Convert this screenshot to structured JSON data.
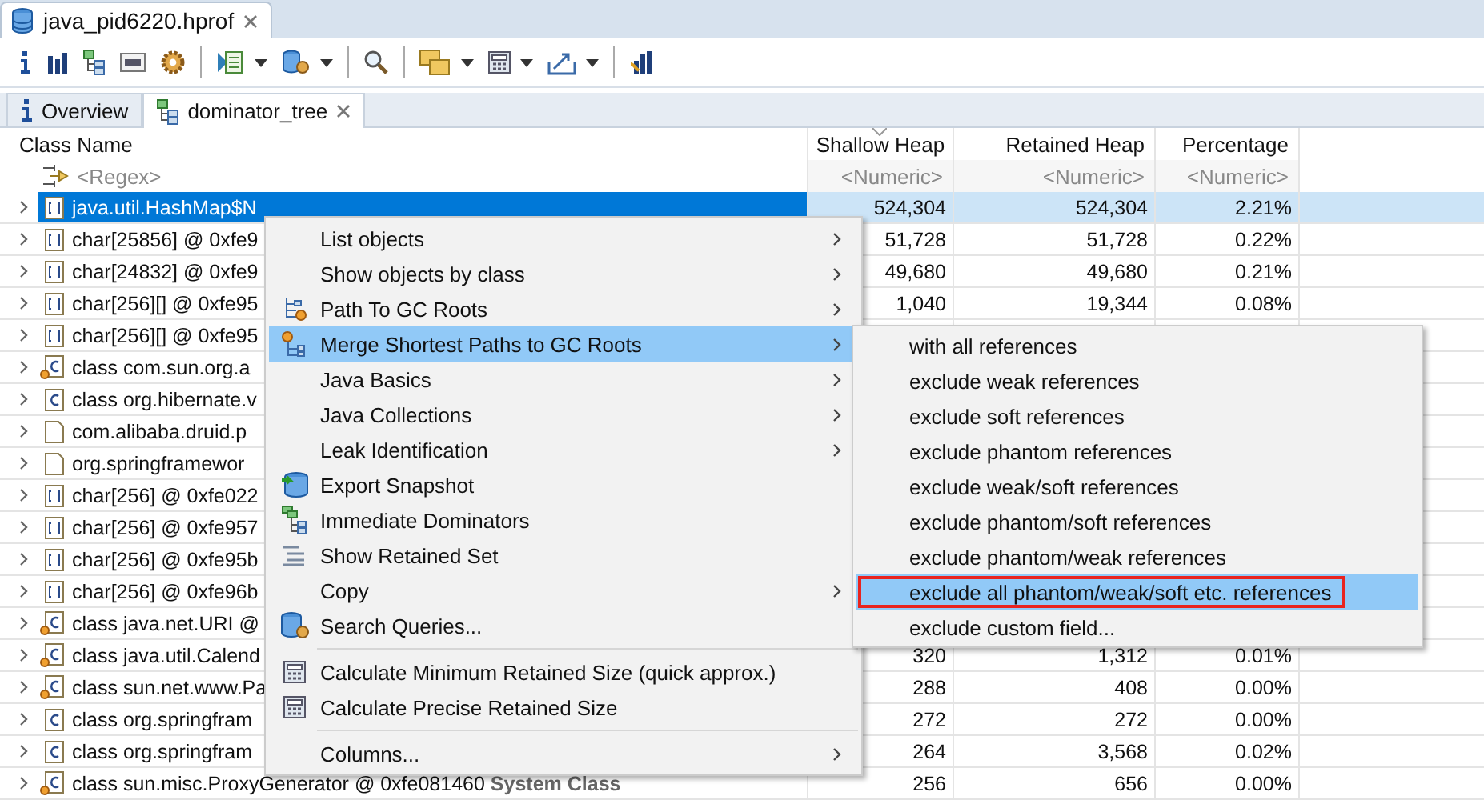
{
  "editor_tab": {
    "title": "java_pid6220.hprof",
    "selected": true
  },
  "view_tabs": [
    {
      "label": "Overview",
      "selected": false
    },
    {
      "label": "dominator_tree",
      "selected": true
    }
  ],
  "table": {
    "columns": [
      {
        "label": "Class Name",
        "filter": "<Regex>"
      },
      {
        "label": "Shallow Heap",
        "filter": "<Numeric>"
      },
      {
        "label": "Retained Heap",
        "filter": "<Numeric>"
      },
      {
        "label": "Percentage",
        "filter": "<Numeric>"
      }
    ],
    "rows": [
      {
        "kind": "array",
        "name": "java.util.HashMap$N",
        "shallow": "524,304",
        "retained": "524,304",
        "percentage": "2.21%",
        "selected": true
      },
      {
        "kind": "array",
        "name": "char[25856] @ 0xfe9",
        "shallow": "51,728",
        "retained": "51,728",
        "percentage": "0.22%",
        "selected": false
      },
      {
        "kind": "array",
        "name": "char[24832] @ 0xfe9",
        "shallow": "49,680",
        "retained": "49,680",
        "percentage": "0.21%",
        "selected": false
      },
      {
        "kind": "array",
        "name": "char[256][] @ 0xfe95",
        "shallow": "1,040",
        "retained": "19,344",
        "percentage": "0.08%",
        "selected": false
      },
      {
        "kind": "array",
        "name": "char[256][] @ 0xfe95",
        "selected": false
      },
      {
        "kind": "class_static",
        "name": "class com.sun.org.a",
        "selected": false
      },
      {
        "kind": "class",
        "name": "class org.hibernate.v",
        "selected": false
      },
      {
        "kind": "object",
        "name": "com.alibaba.druid.p",
        "selected": false
      },
      {
        "kind": "object",
        "name": "org.springframewor",
        "selected": false
      },
      {
        "kind": "array",
        "name": "char[256] @ 0xfe022",
        "selected": false
      },
      {
        "kind": "array",
        "name": "char[256] @ 0xfe957",
        "selected": false
      },
      {
        "kind": "array",
        "name": "char[256] @ 0xfe95b",
        "selected": false
      },
      {
        "kind": "array",
        "name": "char[256] @ 0xfe96b",
        "selected": false
      },
      {
        "kind": "class_static",
        "name": "class java.net.URI @",
        "selected": false
      },
      {
        "kind": "class_static",
        "name": "class java.util.Calend",
        "shallow": "320",
        "retained": "1,312",
        "percentage": "0.01%",
        "selected": false
      },
      {
        "kind": "class_static",
        "name": "class sun.net.www.Pa",
        "shallow": "288",
        "retained": "408",
        "percentage": "0.00%",
        "selected": false
      },
      {
        "kind": "class",
        "name": "class org.springfram",
        "shallow": "272",
        "retained": "272",
        "percentage": "0.00%",
        "selected": false
      },
      {
        "kind": "class",
        "name": "class org.springfram",
        "shallow": "264",
        "retained": "3,568",
        "percentage": "0.02%",
        "selected": false
      },
      {
        "kind": "class_static",
        "name": "class sun.misc.ProxyGenerator @ 0xfe081460 **System Class**",
        "shallow": "256",
        "retained": "656",
        "percentage": "0.00%",
        "selected": false
      }
    ]
  },
  "context_menu": [
    {
      "label": "List objects",
      "submenu": true,
      "selected": false
    },
    {
      "label": "Show objects by class",
      "submenu": true,
      "selected": false
    },
    {
      "label": "Path To GC Roots",
      "submenu": true,
      "selected": false
    },
    {
      "label": "Merge Shortest Paths to GC Roots",
      "submenu": true,
      "selected": true
    },
    {
      "label": "Java Basics",
      "submenu": true,
      "selected": false
    },
    {
      "label": "Java Collections",
      "submenu": true,
      "selected": false
    },
    {
      "label": "Leak Identification",
      "submenu": true,
      "selected": false
    },
    {
      "label": "Export Snapshot",
      "submenu": false,
      "selected": false
    },
    {
      "label": "Immediate Dominators",
      "submenu": false,
      "selected": false
    },
    {
      "label": "Show Retained Set",
      "submenu": false,
      "selected": false
    },
    {
      "label": "Copy",
      "submenu": true,
      "selected": false
    },
    {
      "label": "Search Queries...",
      "submenu": false,
      "selected": false,
      "separator_after": true
    },
    {
      "label": "Calculate Minimum Retained Size (quick approx.)",
      "submenu": false,
      "selected": false
    },
    {
      "label": "Calculate Precise Retained Size",
      "submenu": false,
      "selected": false,
      "separator_after": true
    },
    {
      "label": "Columns...",
      "submenu": true,
      "selected": false
    }
  ],
  "submenu": [
    {
      "label": "with all references",
      "selected": false,
      "outlined": false
    },
    {
      "label": "exclude weak references",
      "selected": false,
      "outlined": false
    },
    {
      "label": "exclude soft references",
      "selected": false,
      "outlined": false
    },
    {
      "label": "exclude phantom references",
      "selected": false,
      "outlined": false
    },
    {
      "label": "exclude weak/soft references",
      "selected": false,
      "outlined": false
    },
    {
      "label": "exclude phantom/soft references",
      "selected": false,
      "outlined": false
    },
    {
      "label": "exclude phantom/weak references",
      "selected": false,
      "outlined": false
    },
    {
      "label": "exclude all phantom/weak/soft etc. references",
      "selected": true,
      "outlined": true
    },
    {
      "label": "exclude custom field...",
      "selected": false,
      "outlined": false
    }
  ]
}
